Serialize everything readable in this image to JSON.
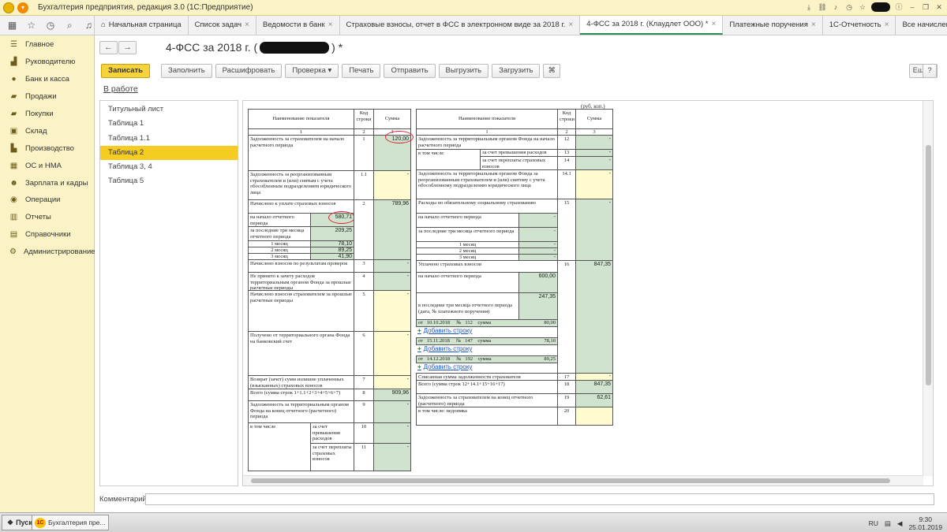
{
  "window": {
    "title": "Бухгалтерия предприятия, редакция 3.0  (1С:Предприятие)"
  },
  "tabs": [
    {
      "label": "Начальная страница"
    },
    {
      "label": "Список задач"
    },
    {
      "label": "Ведомости в банк"
    },
    {
      "label": "Страховые взносы, отчет в ФСС в электронном виде за 2018 г."
    },
    {
      "label": "4-ФСС за 2018 г. (Клаудлет ООО) *"
    },
    {
      "label": "Платежные поручения"
    },
    {
      "label": "1С-Отчетность"
    },
    {
      "label": "Все начисления"
    }
  ],
  "sidebar": {
    "items": [
      {
        "label": "Главное",
        "icon": "menu-icon"
      },
      {
        "label": "Руководителю",
        "icon": "chart-icon"
      },
      {
        "label": "Банк и касса",
        "icon": "bank-icon"
      },
      {
        "label": "Продажи",
        "icon": "sales-icon"
      },
      {
        "label": "Покупки",
        "icon": "cart-icon"
      },
      {
        "label": "Склад",
        "icon": "warehouse-icon"
      },
      {
        "label": "Производство",
        "icon": "factory-icon"
      },
      {
        "label": "ОС и НМА",
        "icon": "assets-icon"
      },
      {
        "label": "Зарплата и кадры",
        "icon": "people-icon"
      },
      {
        "label": "Операции",
        "icon": "operations-icon"
      },
      {
        "label": "Отчеты",
        "icon": "reports-icon"
      },
      {
        "label": "Справочники",
        "icon": "books-icon"
      },
      {
        "label": "Администрирование",
        "icon": "gear-icon"
      }
    ]
  },
  "doc": {
    "title_prefix": "4-ФСС за 2018 г. (",
    "title_suffix": ") *",
    "status": "В работе"
  },
  "toolbar": {
    "save": "Записать",
    "fill": "Заполнить",
    "decode": "Расшифровать",
    "check": "Проверка",
    "print": "Печать",
    "send": "Отправить",
    "export": "Выгрузить",
    "import": "Загрузить",
    "more": "Еще",
    "help": "?"
  },
  "sections": [
    {
      "label": "Титульный лист"
    },
    {
      "label": "Таблица 1"
    },
    {
      "label": "Таблица 1.1"
    },
    {
      "label": "Таблица 2"
    },
    {
      "label": "Таблица 3, 4"
    },
    {
      "label": "Таблица 5"
    }
  ],
  "form": {
    "unit": "(руб. коп.)",
    "left": {
      "h_name": "Наименование показателя",
      "h_code": "Код строки",
      "h_sum": "Сумма",
      "n1": "1",
      "n2": "2",
      "n3": "3",
      "r1_text": "Задолженность за страхователем на начало расчетного периода",
      "r1_code": "1",
      "r1_sum": "120,00",
      "r11_text": "Задолженность за реорганизованным страхователем и (или) снятым с учета обособленным подразделением юридического лица",
      "r11_code": "1.1",
      "r2_text": "Начислено к уплате страховых взносов",
      "r2_code": "2",
      "r2_sum": "789,96",
      "r2_begin": "на начало отчетного периода",
      "r2_begin_v": "580,71",
      "r2_last3": "за последние три месяца отчетного периода",
      "r2_last3_v": "209,25",
      "m1": "1 месяц",
      "m1_v": "78,10",
      "m2": "2 месяц",
      "m2_v": "89,25",
      "m3": "3 месяц",
      "m3_v": "41,90",
      "r3_text": "Начислено взносов по результатам проверок",
      "r3_code": "3",
      "r4_text": "Не принято к зачету расходов территориальным органом Фонда за прошлые расчетные периоды",
      "r4_code": "4",
      "r5_text": "Начислено взносов страхователем за прошлые расчетные периоды",
      "r5_code": "5",
      "r6_text": "Получено от территориального органа Фонда на банковский счет",
      "r6_code": "6",
      "r7_text": "Возврат (зачет) сумм излишне уплаченных (взысканных) страховых взносов",
      "r7_code": "7",
      "r8_text": "Всего (сумма строк 1+1.1+2+3+4+5+6+7)",
      "r8_code": "8",
      "r8_sum": "909,96",
      "r9_text": "Задолженность за территориальным органом Фонда на конец отчетного (расчетного) периода",
      "r9_code": "9",
      "incl": "в том числе",
      "r10_text": "за счет превышения расходов",
      "r10_code": "10",
      "r11b_text": "за счет переплаты страховых взносов",
      "r11b_code": "11",
      "dash": "-"
    },
    "right": {
      "r12_text": "Задолженность за территориальным органом Фонда на начало расчетного периода",
      "r12_code": "12",
      "incl": "в том числе",
      "r13_text": "за счет превышения расходов",
      "r13_code": "13",
      "r14_text": "за счет переплаты страховых взносов",
      "r14_code": "14",
      "r141_text": "Задолженность за территориальным органом Фонда за реорганизованным страхователем и (или) снятому с учета обособленному подразделению юридического лица",
      "r141_code": "14.1",
      "r15_text": "Расходы по обязательному социальному страхованию",
      "r15_code": "15",
      "r15_begin": "на начало отчетного периода",
      "r15_last3": "за последние три месяца отчетного периода",
      "m1": "1 месяц",
      "m2": "2 месяц",
      "m3": "3 месяц",
      "r16_text": "Уплачено страховых взносов",
      "r16_code": "16",
      "r16_sum": "847,35",
      "r16_begin": "на начало отчетного периода",
      "r16_begin_v": "600,00",
      "r16_last3": "в последние три месяца отчетного периода (дата, № платежного поручения)",
      "r16_last3_v": "247,35",
      "p1_date": "10.10.2018",
      "p1_no": "112",
      "p1_sum": "80,00",
      "p2_date": "15.11.2018",
      "p2_no": "147",
      "p2_sum": "78,10",
      "p3_date": "14.12.2018",
      "p3_no": "192",
      "p3_sum": "89,25",
      "from": "от",
      "no": "№",
      "sum": "сумма",
      "add_row": "Добавить строку",
      "r17_text": "Списанная сумма задолженности страхователя",
      "r17_code": "17",
      "r18_text": "Всего (сумма строк 12+14.1+15+16+17)",
      "r18_code": "18",
      "r18_sum": "847,35",
      "r19_text": "Задолженность за страхователем на конец отчетного (расчетного) периода",
      "r19_code": "19",
      "r19_sum": "62,61",
      "r20_text": "в том числе: недоимка",
      "r20_code": "20",
      "dash": "-"
    }
  },
  "comment": {
    "label": "Комментарий:"
  },
  "taskbar": {
    "start": "Пуск",
    "task": "Бухгалтерия пре...",
    "lang": "RU",
    "time": "9:30",
    "date": "25.01.2019"
  }
}
